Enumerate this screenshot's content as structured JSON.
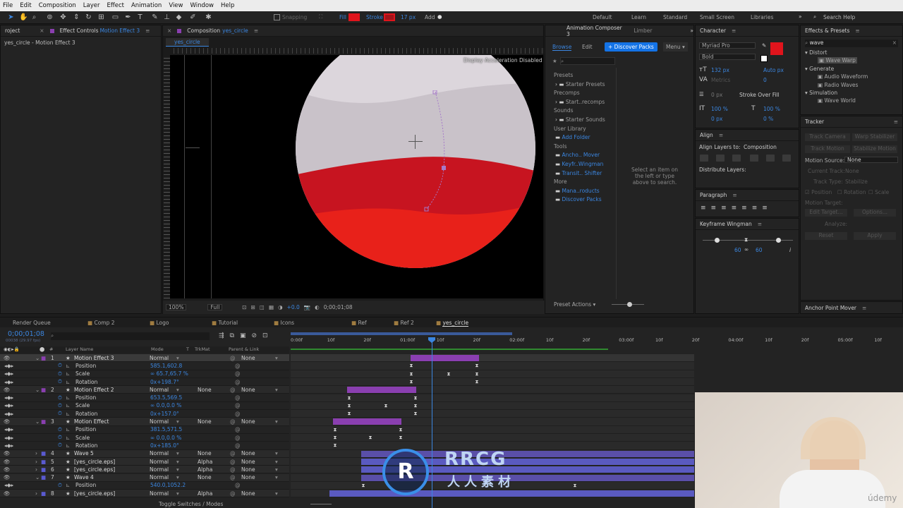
{
  "menu": [
    "File",
    "Edit",
    "Composition",
    "Layer",
    "Effect",
    "Animation",
    "View",
    "Window",
    "Help"
  ],
  "toolbar": {
    "snapping": "Snapping",
    "fill": "Fill",
    "stroke": "Stroke",
    "stroke_width": "17 px",
    "add": "Add",
    "workspaces": [
      "Default",
      "Learn",
      "Standard",
      "Small Screen",
      "Libraries"
    ],
    "search_placeholder": "Search Help",
    "fill_color": "#e0141c",
    "stroke_color": "#a11419"
  },
  "project_panel": {
    "tab": "roject",
    "effect_controls": "Effect Controls",
    "effect_controls_target": "Motion Effect 3",
    "subtitle": "yes_circle - Motion Effect 3"
  },
  "composition_panel": {
    "tab": "Composition",
    "tab_name": "yes_circle",
    "subtab": "yes_circle",
    "accel_note": "Display Acceleration Disabled",
    "zoom": "100%",
    "quality": "Full",
    "exposure": "+0.0",
    "timecode": "0;00;01;08"
  },
  "anim_composer": {
    "tab": "Animation Composer 3",
    "tab2": "Limber",
    "browse": "Browse",
    "edit": "Edit",
    "discover": "Discover Packs",
    "menu": "Menu",
    "sections": [
      {
        "title": "Presets",
        "items": [
          "Starter Presets"
        ]
      },
      {
        "title": "Precomps",
        "items": [
          "Start..recomps"
        ]
      },
      {
        "title": "Sounds",
        "items": [
          "Starter Sounds"
        ]
      },
      {
        "title": "User Library",
        "items": [
          "Add Folder"
        ]
      },
      {
        "title": "Tools",
        "items": [
          "Ancho.. Mover",
          "Keyfr..Wingman",
          "Transit.. Shifter"
        ]
      },
      {
        "title": "More",
        "items": [
          "Mana..roducts",
          "Discover Packs"
        ]
      }
    ],
    "hint": "Select an item on the left or type above to search.",
    "preset_actions": "Preset Actions"
  },
  "character": {
    "tab": "Character",
    "font": "Myriad Pro",
    "style": "Bold",
    "size": "132 px",
    "leading": "Auto px",
    "kerning": "Metrics",
    "tracking": "0",
    "stroke_width": "0 px",
    "stroke_mode": "Stroke Over Fill",
    "vscale": "100 %",
    "hscale": "100 %",
    "baseline": "0 px",
    "tsume": "0 %"
  },
  "align": {
    "tab": "Align",
    "align_to_label": "Align Layers to:",
    "align_to": "Composition",
    "distribute": "Distribute Layers:"
  },
  "paragraph": {
    "tab": "Paragraph"
  },
  "keyframe_wingman": {
    "tab": "Keyframe Wingman",
    "left": "60",
    "right": "60"
  },
  "effects_presets": {
    "tab": "Effects & Presets",
    "search": "wave",
    "groups": [
      {
        "name": "Distort",
        "items": [
          "Wave Warp"
        ]
      },
      {
        "name": "Generate",
        "items": [
          "Audio Waveform",
          "Radio Waves"
        ]
      },
      {
        "name": "Simulation",
        "items": [
          "Wave World"
        ]
      }
    ]
  },
  "tracker": {
    "tab": "Tracker",
    "buttons": [
      "Track Camera",
      "Warp Stabilizer",
      "Track Motion",
      "Stabilize Motion"
    ],
    "motion_source_label": "Motion Source:",
    "motion_source": "None",
    "current_track_label": "Current Track:",
    "current_track": "None",
    "track_type_label": "Track Type:",
    "track_type": "Stabilize",
    "checks": [
      "Position",
      "Rotation",
      "Scale"
    ],
    "motion_target": "Motion Target:",
    "edit_target": "Edit Target...",
    "options": "Options...",
    "analyze": "Analyze:",
    "reset": "Reset",
    "apply": "Apply"
  },
  "anchor_mover": {
    "tab": "Anchor Point Mover"
  },
  "timeline_tabs": [
    "Render Queue",
    "Comp 2",
    "Logo",
    "Tutorial",
    "Icons",
    "Ref",
    "Ref 2",
    "yes_circle"
  ],
  "timeline": {
    "timecode": "0;00;01;08",
    "fps": "00038 (29.97 fps)",
    "columns": {
      "layer_name": "Layer Name",
      "mode": "Mode",
      "t": "T",
      "trkmat": "TrkMat",
      "parent": "Parent & Link"
    },
    "ruler": [
      "0:00f",
      "10f",
      "20f",
      "01:00f",
      "10f",
      "20f",
      "02:00f",
      "10f",
      "20f",
      "03:00f",
      "10f",
      "20f",
      "04:00f",
      "10f",
      "20f",
      "05:00f",
      "10f"
    ],
    "footer": "Toggle Switches / Modes",
    "rows": [
      {
        "num": "1",
        "name": "Motion Effect 3",
        "type": "layer",
        "mode": "Normal",
        "trk": "",
        "parent": "None",
        "color": "#8a3fb0",
        "selected": true
      },
      {
        "num": "",
        "name": "Position",
        "type": "prop",
        "value": "585.1,602.8"
      },
      {
        "num": "",
        "name": "Scale",
        "type": "prop",
        "value": "∞ 65.7,65.7 %"
      },
      {
        "num": "",
        "name": "Rotation",
        "type": "prop",
        "value": "0x+198.7°"
      },
      {
        "num": "2",
        "name": "Motion Effect 2",
        "type": "layer",
        "mode": "Normal",
        "trk": "None",
        "parent": "None",
        "color": "#8a3fb0"
      },
      {
        "num": "",
        "name": "Position",
        "type": "prop",
        "value": "653.5,569.5"
      },
      {
        "num": "",
        "name": "Scale",
        "type": "prop",
        "value": "∞ 0.0,0.0 %"
      },
      {
        "num": "",
        "name": "Rotation",
        "type": "prop",
        "value": "0x+157.0°"
      },
      {
        "num": "3",
        "name": "Motion Effect",
        "type": "layer",
        "mode": "Normal",
        "trk": "None",
        "parent": "None",
        "color": "#8a3fb0"
      },
      {
        "num": "",
        "name": "Position",
        "type": "prop",
        "value": "381.5,571.5"
      },
      {
        "num": "",
        "name": "Scale",
        "type": "prop",
        "value": "∞ 0.0,0.0 %"
      },
      {
        "num": "",
        "name": "Rotation",
        "type": "prop",
        "value": "0x+185.0°"
      },
      {
        "num": "4",
        "name": "Wave 5",
        "type": "layer",
        "mode": "Normal",
        "trk": "None",
        "parent": "None",
        "color": "#5a5ad0"
      },
      {
        "num": "5",
        "name": "[yes_circle.eps]",
        "type": "layer",
        "mode": "Normal",
        "trk": "Alpha",
        "parent": "None",
        "color": "#5a5ad0"
      },
      {
        "num": "6",
        "name": "[yes_circle.eps]",
        "type": "layer",
        "mode": "Normal",
        "trk": "Alpha",
        "parent": "None",
        "color": "#5a5ad0"
      },
      {
        "num": "7",
        "name": "Wave 4",
        "type": "layer",
        "mode": "Normal",
        "trk": "None",
        "parent": "None",
        "color": "#5a5ad0"
      },
      {
        "num": "",
        "name": "Position",
        "type": "prop",
        "value": "540.0,1052.2"
      },
      {
        "num": "8",
        "name": "[yes_circle.eps]",
        "type": "layer",
        "mode": "Normal",
        "trk": "Alpha",
        "parent": "None",
        "color": "#5a5ad0"
      }
    ]
  },
  "watermark": {
    "big": "RRCG",
    "sub": "人人素材",
    "brand": "údemy"
  }
}
